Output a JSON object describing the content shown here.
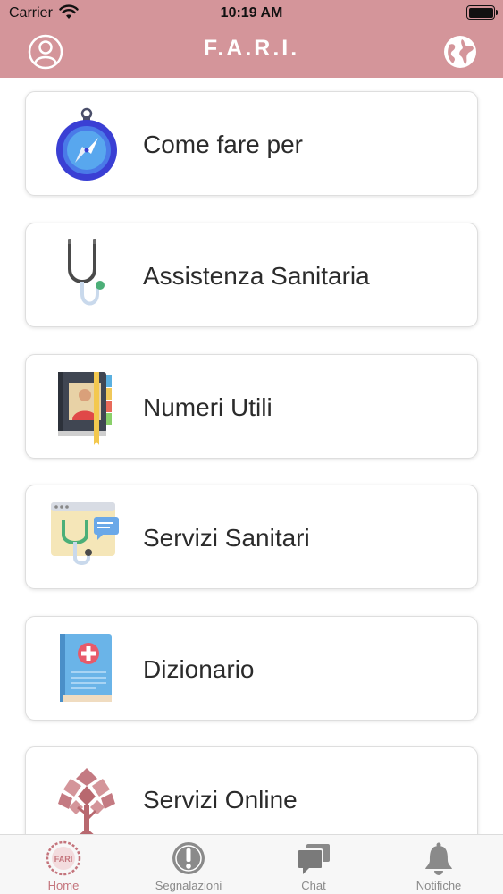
{
  "status_bar": {
    "carrier": "Carrier",
    "time": "10:19 AM"
  },
  "header": {
    "title": "F.A.R.I.",
    "profile_icon": "user-circle-icon",
    "language_icon": "globe-icon",
    "background": "#d4959a"
  },
  "menu": {
    "items": [
      {
        "label": "Come fare per",
        "icon": "compass-icon"
      },
      {
        "label": "Assistenza Sanitaria",
        "icon": "stethoscope-icon"
      },
      {
        "label": "Numeri Utili",
        "icon": "address-book-icon"
      },
      {
        "label": "Servizi Sanitari",
        "icon": "health-services-icon"
      },
      {
        "label": "Dizionario",
        "icon": "medical-book-icon"
      },
      {
        "label": "Servizi Online",
        "icon": "tree-icon"
      }
    ]
  },
  "tabbar": {
    "tabs": [
      {
        "label": "Home",
        "icon": "fari-logo-icon",
        "active": true
      },
      {
        "label": "Segnalazioni",
        "icon": "exclamation-circle-icon",
        "active": false
      },
      {
        "label": "Chat",
        "icon": "chat-bubbles-icon",
        "active": false
      },
      {
        "label": "Notifiche",
        "icon": "bell-icon",
        "active": false
      }
    ]
  },
  "colors": {
    "accent": "#d4959a",
    "active_tab": "#c4747c",
    "inactive_tab": "#8a8a8a"
  }
}
